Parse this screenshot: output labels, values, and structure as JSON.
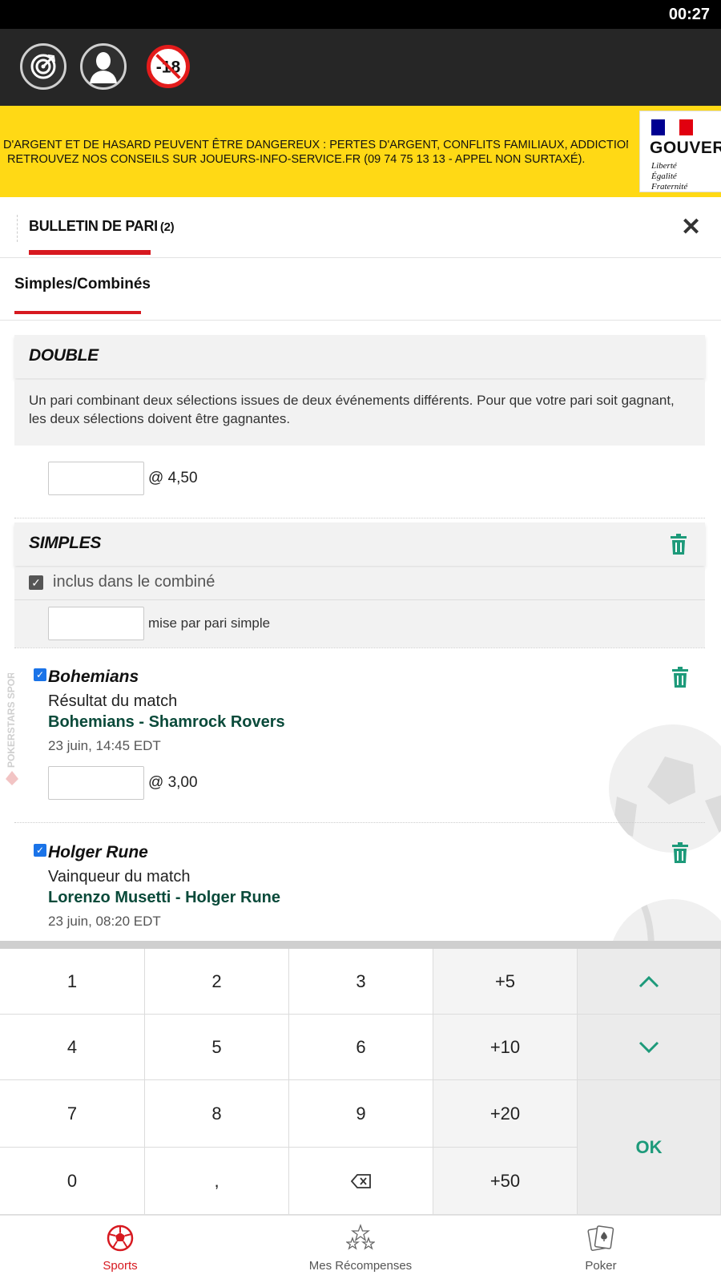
{
  "status_bar": {
    "time": "00:27"
  },
  "banner": {
    "line1": "D'ARGENT ET DE HASARD PEUVENT ÊTRE DANGEREUX : PERTES D'ARGENT, CONFLITS FAMILIAUX, ADDICTION...",
    "line2": "RETROUVEZ NOS CONSEILS SUR JOUEURS-INFO-SERVICE.FR (09 74 75 13 13 - APPEL NON SURTAXÉ).",
    "gov_name": "GOUVERNEMENT",
    "gov_motto": [
      "Liberté",
      "Égalité",
      "Fraternité"
    ]
  },
  "age_badge": "-18",
  "slip": {
    "title": "BULLETIN DE PARI",
    "count": "(2)",
    "close": "✕"
  },
  "tabs": {
    "active": "Simples/Combinés"
  },
  "double": {
    "label": "DOUBLE",
    "description": "Un pari combinant deux sélections issues de deux événements différents. Pour que votre pari soit gagnant, les deux sélections doivent être gagnantes.",
    "odds": "@ 4,50"
  },
  "simples": {
    "label": "SIMPLES",
    "included_label": "inclus dans le combiné",
    "stake_label": "mise par pari simple"
  },
  "selections": [
    {
      "name": "Bohemians",
      "market": "Résultat du match",
      "event": "Bohemians - Shamrock Rovers",
      "date": "23 juin, 14:45 EDT",
      "odds": "@ 3,00"
    },
    {
      "name": "Holger Rune",
      "market": "Vainqueur du match",
      "event": "Lorenzo Musetti - Holger Rune",
      "date": "23 juin, 08:20 EDT"
    }
  ],
  "brand_watermark": "POKERSTARS SPORTS",
  "keypad": {
    "keys": [
      "1",
      "2",
      "3",
      "+5",
      "4",
      "5",
      "6",
      "+10",
      "7",
      "8",
      "9",
      "+20",
      "0",
      ",",
      "⌫",
      "+50"
    ],
    "ok": "OK"
  },
  "bottom_nav": [
    {
      "label": "Sports",
      "icon": "soccer-ball-icon"
    },
    {
      "label": "Mes Récompenses",
      "icon": "stars-icon"
    },
    {
      "label": "Poker",
      "icon": "cards-icon"
    }
  ],
  "colors": {
    "accent_red": "#d71920",
    "accent_green": "#1d9a7a",
    "banner_yellow": "#ffd915",
    "topbar": "#262626"
  }
}
